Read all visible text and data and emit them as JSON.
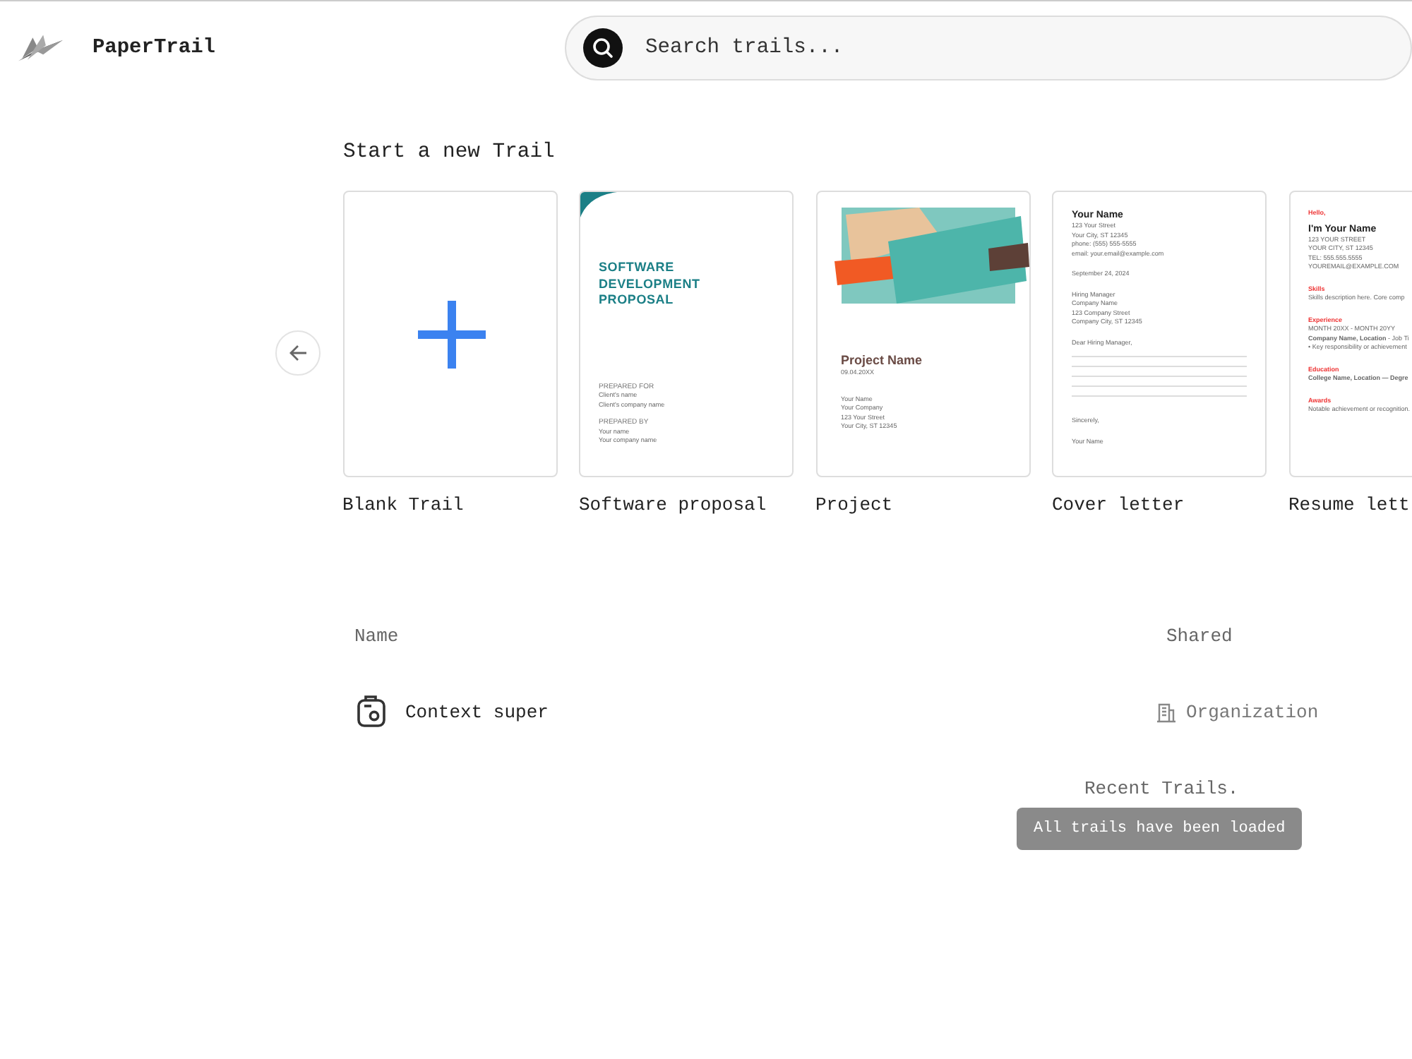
{
  "app": {
    "name": "PaperTrail"
  },
  "search": {
    "placeholder": "Search trails..."
  },
  "templates_section": {
    "title": "Start a new Trail"
  },
  "templates": [
    {
      "kind": "blank",
      "label": "Blank Trail"
    },
    {
      "kind": "proposal",
      "label": "Software proposal",
      "preview": [
        {
          "kind": "title",
          "text": "SOFTWARE DEVELOPMENT PROPOSAL"
        },
        {
          "kind": "label",
          "text": "PREPARED FOR"
        },
        {
          "kind": "text",
          "text": "Client's name"
        },
        {
          "kind": "text",
          "text": "Client's company name"
        },
        {
          "kind": "label",
          "text": "PREPARED BY"
        },
        {
          "kind": "text",
          "text": "Your name"
        },
        {
          "kind": "text",
          "text": "Your company name"
        }
      ]
    },
    {
      "kind": "project",
      "label": "Project",
      "preview": [
        {
          "kind": "heading",
          "text": "Project Name"
        },
        {
          "kind": "text",
          "text": "09.04.20XX"
        },
        {
          "kind": "para",
          "text": "Your Name"
        },
        {
          "kind": "text",
          "text": "Your Company"
        },
        {
          "kind": "text",
          "text": "123 Your Street"
        },
        {
          "kind": "text",
          "text": "Your City, ST 12345"
        }
      ]
    },
    {
      "kind": "letter",
      "label": "Cover letter",
      "preview": [
        {
          "kind": "name",
          "text": "Your Name"
        },
        {
          "kind": "text",
          "text": "123 Your Street"
        },
        {
          "kind": "text",
          "text": "Your City, ST 12345"
        },
        {
          "kind": "text",
          "text": "phone: (555) 555-5555"
        },
        {
          "kind": "text",
          "text": "email: your.email@example.com"
        },
        {
          "kind": "para",
          "text": "September 24, 2024"
        },
        {
          "kind": "para",
          "text": "Hiring Manager"
        },
        {
          "kind": "text",
          "text": "Company Name"
        },
        {
          "kind": "text",
          "text": "123 Company Street"
        },
        {
          "kind": "text",
          "text": "Company City, ST 12345"
        },
        {
          "kind": "salutation",
          "text": "Dear Hiring Manager,"
        },
        {
          "kind": "closing",
          "text": "Sincerely,"
        },
        {
          "kind": "para",
          "text": "Your Name"
        }
      ]
    },
    {
      "kind": "resume",
      "label": "Resume lett",
      "preview": [
        {
          "kind": "section",
          "text": "Hello,"
        },
        {
          "kind": "name",
          "text": "I'm Your Name"
        },
        {
          "kind": "text",
          "text": "123 YOUR STREET"
        },
        {
          "kind": "text",
          "text": "YOUR CITY, ST 12345"
        },
        {
          "kind": "text",
          "text": "TEL: 555.555.5555"
        },
        {
          "kind": "text",
          "text": "YOUREMAIL@EXAMPLE.COM"
        },
        {
          "kind": "section",
          "text": "Skills"
        },
        {
          "kind": "text",
          "text": "Skills description here. Core comp"
        },
        {
          "kind": "section",
          "text": "Experience"
        },
        {
          "kind": "text",
          "text": "MONTH 20XX - MONTH 20YY"
        },
        {
          "kind": "text",
          "text": "**Company Name, Location** - Job Ti"
        },
        {
          "kind": "text",
          "text": "• Key responsibility or achievement"
        },
        {
          "kind": "section",
          "text": "Education"
        },
        {
          "kind": "text",
          "text": "**College Name, Location — Degre**"
        },
        {
          "kind": "section",
          "text": "Awards"
        },
        {
          "kind": "text",
          "text": "Notable achievement or recognition."
        }
      ]
    }
  ],
  "trails": {
    "columns": [
      "Name",
      "Shared"
    ],
    "rows": [
      {
        "name": "Context super",
        "shared": "Organization"
      }
    ]
  },
  "footer_note": "Recent Trails.",
  "toast": "All trails have been loaded"
}
